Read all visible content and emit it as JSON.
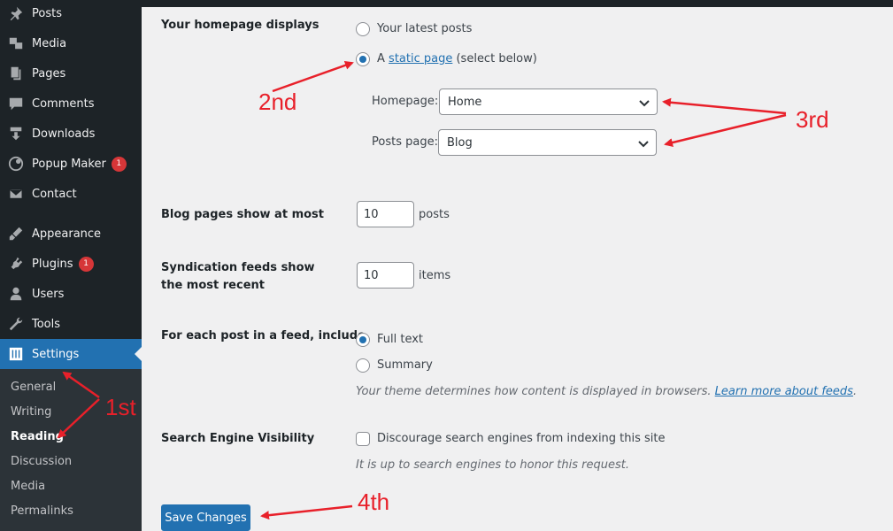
{
  "sidebar": {
    "items": [
      {
        "label": "Posts",
        "icon": "pin-icon"
      },
      {
        "label": "Media",
        "icon": "media-icon"
      },
      {
        "label": "Pages",
        "icon": "pages-icon"
      },
      {
        "label": "Comments",
        "icon": "comment-icon"
      },
      {
        "label": "Downloads",
        "icon": "download-icon"
      },
      {
        "label": "Popup Maker",
        "icon": "popup-icon",
        "badge": "1"
      },
      {
        "label": "Contact",
        "icon": "mail-icon"
      },
      {
        "label": "Appearance",
        "icon": "brush-icon"
      },
      {
        "label": "Plugins",
        "icon": "plugin-icon",
        "badge": "1"
      },
      {
        "label": "Users",
        "icon": "users-icon"
      },
      {
        "label": "Tools",
        "icon": "wrench-icon"
      },
      {
        "label": "Settings",
        "icon": "settings-icon"
      }
    ],
    "submenu": [
      "General",
      "Writing",
      "Reading",
      "Discussion",
      "Media",
      "Permalinks"
    ],
    "current_sub": "Reading"
  },
  "homepage_displays": {
    "label": "Your homepage displays",
    "option_latest": "Your latest posts",
    "option_static_prefix": "A",
    "option_static_link": "static page",
    "option_static_suffix": "(select below)",
    "selected": "static",
    "homepage_label": "Homepage:",
    "homepage_value": "Home",
    "posts_page_label": "Posts page:",
    "posts_page_value": "Blog"
  },
  "blog_pages": {
    "label": "Blog pages show at most",
    "value": "10",
    "unit": "posts"
  },
  "syndication": {
    "label": "Syndication feeds show the most recent",
    "value": "10",
    "unit": "items"
  },
  "feed_include": {
    "label": "For each post in a feed, include",
    "option_full": "Full text",
    "option_summary": "Summary",
    "selected": "full",
    "desc_text": "Your theme determines how content is displayed in browsers.",
    "desc_link": "Learn more about feeds"
  },
  "search_visibility": {
    "label": "Search Engine Visibility",
    "checkbox_label": "Discourage search engines from indexing this site",
    "checked": false,
    "desc": "It is up to search engines to honor this request."
  },
  "save_label": "Save Changes",
  "annotations": {
    "first": "1st",
    "second": "2nd",
    "third": "3rd",
    "fourth": "4th"
  },
  "colors": {
    "accent": "#2271b1",
    "sidebar": "#1d2327",
    "annotation": "#e8202a",
    "badge": "#d63638"
  }
}
